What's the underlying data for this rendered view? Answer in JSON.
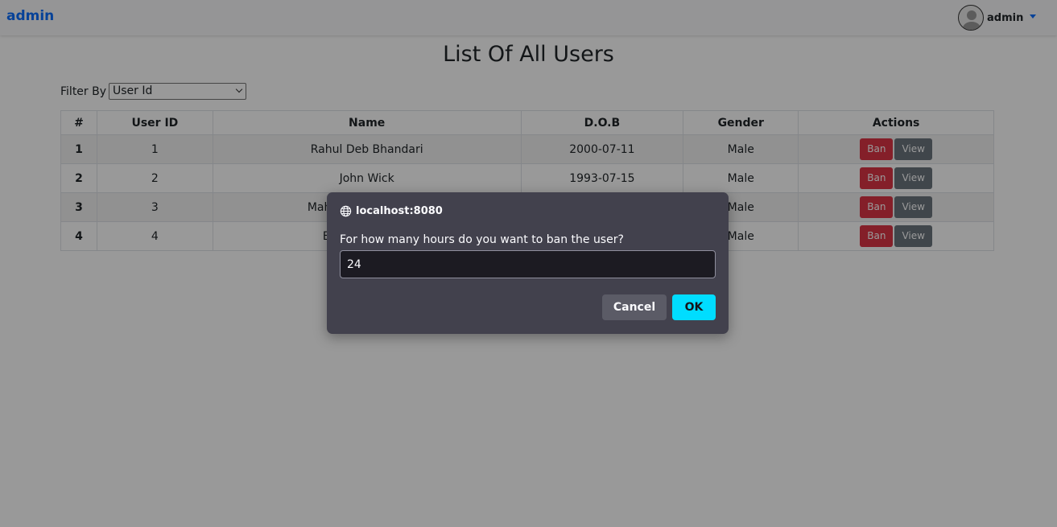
{
  "navbar": {
    "brand": "admin",
    "user_name": "admin",
    "avatar_icon": "user-avatar-icon",
    "caret_icon": "caret-down-icon",
    "accent_color": "#0d6efd"
  },
  "page": {
    "title": "List Of All Users"
  },
  "filter": {
    "label": "Filter By",
    "selected": "User Id"
  },
  "table": {
    "headers": [
      "#",
      "User ID",
      "Name",
      "D.O.B",
      "Gender",
      "Actions"
    ],
    "rows": [
      {
        "num": "1",
        "user_id": "1",
        "name": "Rahul Deb Bhandari",
        "dob": "2000-07-11",
        "gender": "Male"
      },
      {
        "num": "2",
        "user_id": "2",
        "name": "John Wick",
        "dob": "1993-07-15",
        "gender": "Male"
      },
      {
        "num": "3",
        "user_id": "3",
        "name": "Mah",
        "dob": "",
        "gender": "Male"
      },
      {
        "num": "4",
        "user_id": "4",
        "name": "E",
        "dob": "",
        "gender": "Male"
      }
    ],
    "ban_label": "Ban",
    "view_label": "View",
    "ban_color": "#dc3545",
    "view_color": "#6c757d"
  },
  "dialog": {
    "origin": "localhost:8080",
    "origin_icon": "globe-icon",
    "message": "For how many hours do you want to ban the user?",
    "input_value": "24",
    "cancel_label": "Cancel",
    "ok_label": "OK",
    "ok_color": "#00ddff"
  }
}
